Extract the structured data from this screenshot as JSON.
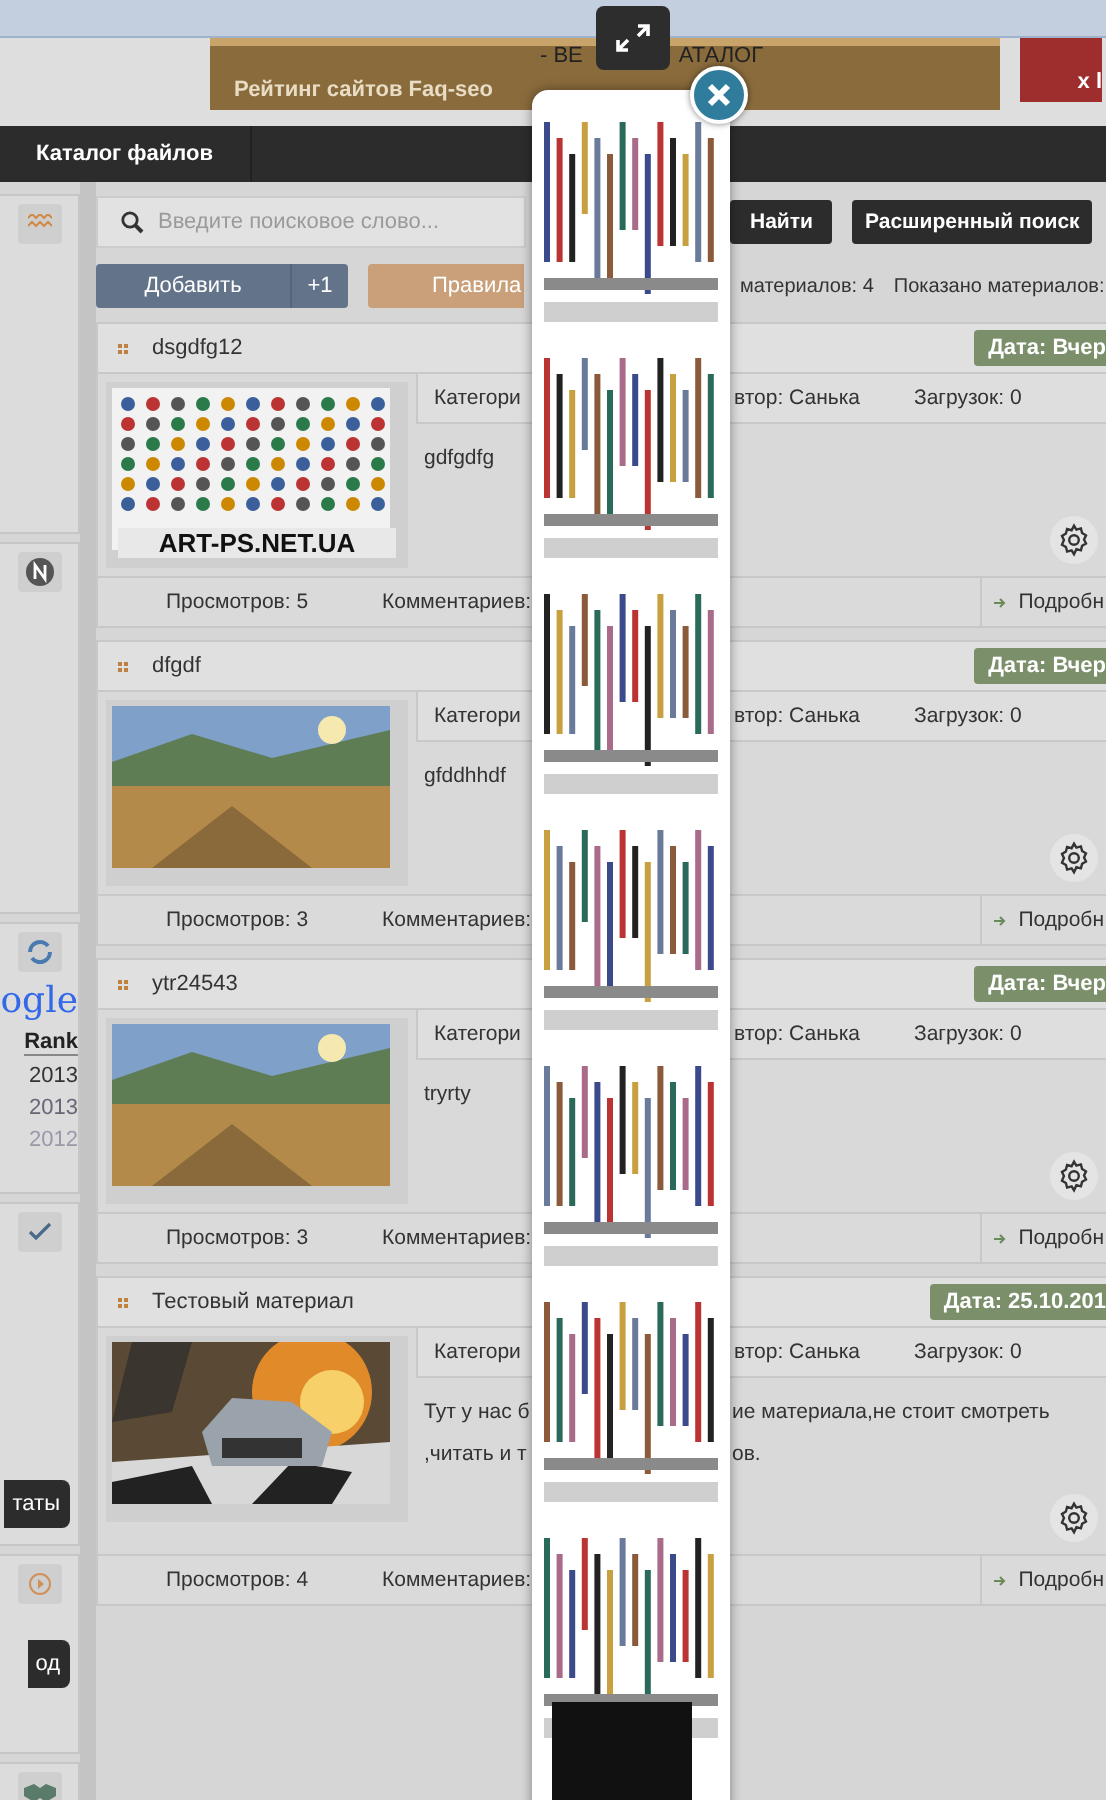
{
  "banner": {
    "top_left": "- ВЕ",
    "top_right": "АТАЛОГ",
    "caption": "Рейтинг сайтов Faq-seo",
    "side_text": "x l"
  },
  "nav": {
    "items": [
      "Каталог файлов"
    ]
  },
  "sidebar": {
    "logo_text": "ogle",
    "rank_header": "Rank",
    "rank_rows": [
      "2013",
      "2013",
      "2012"
    ],
    "buttons": [
      "таты",
      "од"
    ]
  },
  "search": {
    "placeholder": "Введите поисковое слово...",
    "find": "Найти",
    "advanced": "Расширенный поиск"
  },
  "toolbar": {
    "add": "Добавить",
    "add_count": "+1",
    "rules": "Правила",
    "total": "материалов: 4",
    "shown": "Показано материалов:"
  },
  "entries": [
    {
      "title": "dsgdfg12",
      "date": "Дата: Вчер",
      "category": "Категори",
      "author": "втор: Санька",
      "downloads": "Загрузок: 0",
      "description": [
        {
          "left": "gdfgdfg"
        }
      ],
      "views": "Просмотров: 5",
      "comments": "Комментариев:",
      "more": "Подробн",
      "thumb_caption": "ART-PS.NET.UA"
    },
    {
      "title": "dfgdf",
      "date": "Дата: Вчер",
      "category": "Категори",
      "author": "втор: Санька",
      "downloads": "Загрузок: 0",
      "description": [
        {
          "left": "gfddhhdf"
        }
      ],
      "views": "Просмотров: 3",
      "comments": "Комментариев:",
      "more": "Подробн"
    },
    {
      "title": "ytr24543",
      "date": "Дата: Вчер",
      "category": "Категори",
      "author": "втор: Санька",
      "downloads": "Загрузок: 0",
      "description": [
        {
          "left": "tryrty"
        }
      ],
      "views": "Просмотров: 3",
      "comments": "Комментариев:",
      "more": "Подробн"
    },
    {
      "title": "Тестовый материал",
      "date": "Дата: 25.10.201",
      "category": "Категори",
      "author": "втор: Санька",
      "downloads": "Загрузок: 0",
      "description": [
        {
          "left": "Тут у нас б",
          "right": "ие материала,не стоит смотреть"
        },
        {
          "left": ",читать и т",
          "right": "ов."
        }
      ],
      "views": "Просмотров: 4",
      "comments": "Комментариев:",
      "more": "Подробн"
    }
  ]
}
